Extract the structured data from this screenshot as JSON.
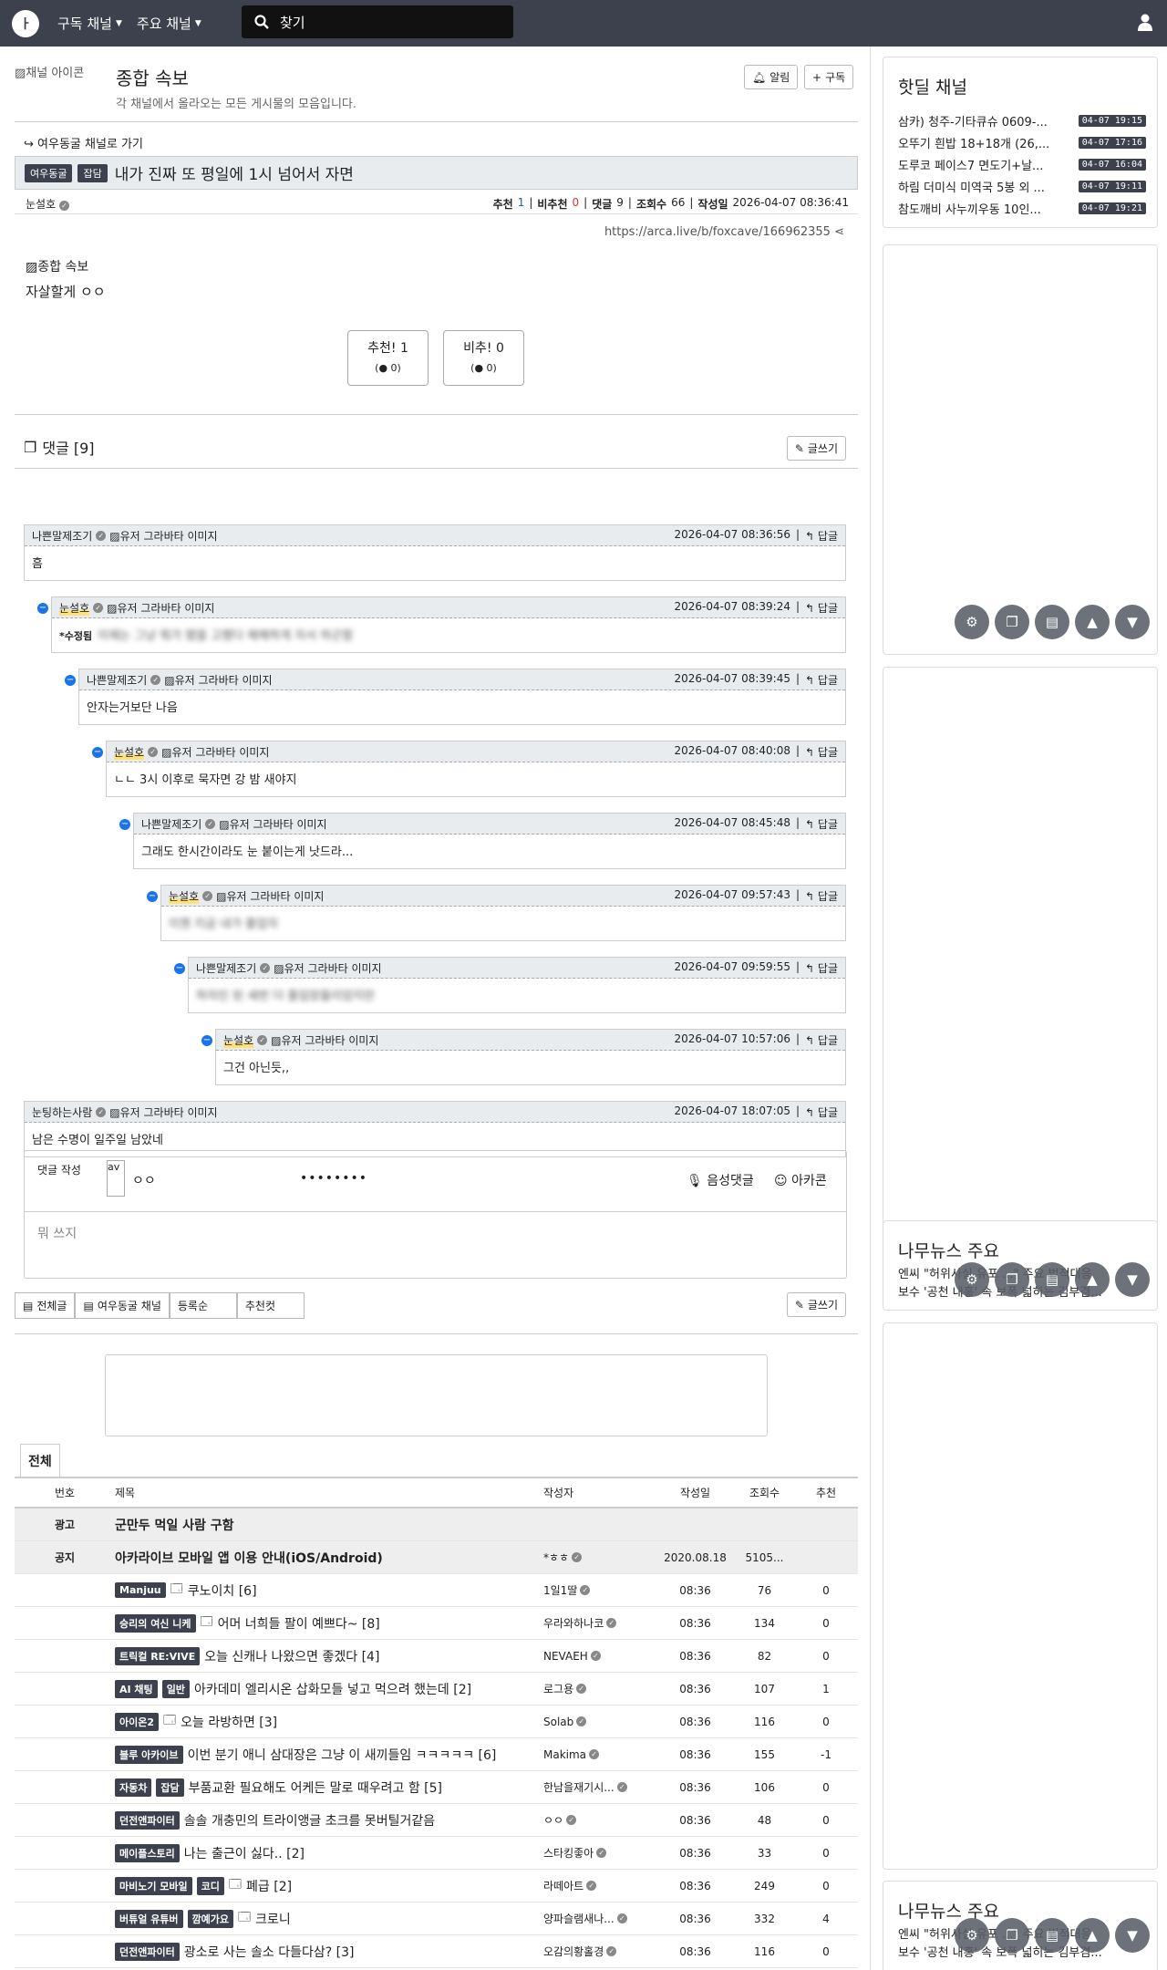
{
  "nav": {
    "menu1": "구독 채널",
    "menu2": "주요 채널",
    "search_placeholder": "찾기"
  },
  "header": {
    "channel_img_alt": "채널 아이콘",
    "title": "종합 속보",
    "desc": "각 채널에서 올라오는 모든 게시물의 모음입니다.",
    "alarm": "알림",
    "subscribe": "구독"
  },
  "post": {
    "goto": "여우동굴 채널로 가기",
    "cat1": "여우동굴",
    "cat2": "잡담",
    "title": "내가 진짜 또 평일에 1시 넘어서 자면",
    "author": "눈설호",
    "rec_label": "추천",
    "rec": "1",
    "unrec_label": "비추천",
    "unrec": "0",
    "cmt_label": "댓글",
    "cmt": "9",
    "view_label": "조회수",
    "views": "66",
    "date_label": "작성일",
    "date": "2026-04-07 08:36:41",
    "url": "https://arca.live/b/foxcave/166962355",
    "img_alt": "종합 속보",
    "body": "자살할게 ㅇㅇ",
    "vote_up": "추천! 1",
    "vote_up_sub": "0",
    "vote_down": "비추! 0",
    "vote_down_sub": "0"
  },
  "comments": {
    "header": "댓글 [9]",
    "write": "글쓰기",
    "reply": "답글",
    "avatar_alt": "유저 그라바타 이미지",
    "items": [
      {
        "author": "나쁜말제조기",
        "date": "2026-04-07 08:36:56",
        "text": "흠"
      },
      {
        "author": "눈설호",
        "date": "2026-04-07 08:39:24",
        "text": "이제는 그냥 뭐가 됐을 고했다 해해하게 자서 하곤함",
        "edited": "*수정됨"
      },
      {
        "author": "나쁜말제조기",
        "date": "2026-04-07 08:39:45",
        "text": "안자는거보단 나음"
      },
      {
        "author": "눈설호",
        "date": "2026-04-07 08:40:08",
        "text": "ㄴㄴ 3시 이후로 묵자면 강 밤 새야지"
      },
      {
        "author": "나쁜말제조기",
        "date": "2026-04-07 08:45:48",
        "text": "그래도 한시간이라도 눈 붙이는게 낫드라..."
      },
      {
        "author": "눈설호",
        "date": "2026-04-07 09:57:43",
        "text": "이젠 지금 내가 졸업자"
      },
      {
        "author": "나쁜말제조기",
        "date": "2026-04-07 09:59:55",
        "text": "하자인 된 세번 더 졸업장들이었지만"
      },
      {
        "author": "눈설호",
        "date": "2026-04-07 10:57:06",
        "text": "그건 아닌듯,,"
      },
      {
        "author": "눈팅하는사람",
        "date": "2026-04-07 18:07:05",
        "text": "남은 수명이 일주일 남았네"
      }
    ]
  },
  "form": {
    "label": "댓글 작성",
    "avatar": "av",
    "nick": "ㅇㅇ",
    "pw": "••••••••",
    "voice": "음성댓글",
    "arcacon": "아카콘",
    "placeholder": "뭐 쓰지"
  },
  "tabs": {
    "all": "전체글",
    "channel": "여우동굴 채널",
    "reg": "등록순",
    "best": "추천컷",
    "write": "글쓰기"
  },
  "list": {
    "tab": "전체",
    "headers": {
      "no": "번호",
      "title": "제목",
      "author": "작성자",
      "date": "작성일",
      "views": "조회수",
      "rec": "추천"
    },
    "ad": {
      "no": "광고",
      "title": "군만두 먹일 사람 구함"
    },
    "notice": {
      "no": "공지",
      "title": "아카라이브 모바일 앱 이용 안내(iOS/Android)",
      "author": "*ㅎㅎ",
      "date": "2020.08.18",
      "views": "5105..."
    },
    "rows": [
      {
        "badges": [
          "Manjuu"
        ],
        "icon": true,
        "title": "쿠노이치 [6]",
        "author": "1일1딸",
        "date": "08:36",
        "views": "76",
        "rec": "0"
      },
      {
        "badges": [
          "승리의 여신 니케"
        ],
        "icon": true,
        "title": "어머 너희들 팔이 예쁘다~ [8]",
        "author": "우라와하나코",
        "date": "08:36",
        "views": "134",
        "rec": "0"
      },
      {
        "badges": [
          "트릭컬 RE:VIVE"
        ],
        "icon": false,
        "title": "오늘 신캐나 나왔으면 좋겠다 [4]",
        "author": "NEVAEH",
        "date": "08:36",
        "views": "82",
        "rec": "0"
      },
      {
        "badges": [
          "AI 채팅",
          "일반"
        ],
        "icon": false,
        "title": "아카데미 엘리시온 삽화모들 넣고 먹으려 했는데 [2]",
        "author": "로그용",
        "date": "08:36",
        "views": "107",
        "rec": "1"
      },
      {
        "badges": [
          "아이온2"
        ],
        "icon": true,
        "title": "오늘 라방하면 [3]",
        "author": "Solab",
        "date": "08:36",
        "views": "116",
        "rec": "0"
      },
      {
        "badges": [
          "블루 아카이브"
        ],
        "icon": false,
        "title": "이번 분기 애니 삼대장은 그냥 이 새끼들임 ㅋㅋㅋㅋㅋ [6]",
        "author": "Makima",
        "date": "08:36",
        "views": "155",
        "rec": "-1"
      },
      {
        "badges": [
          "자동차",
          "잡담"
        ],
        "icon": false,
        "title": "부품교환 필요해도 어케든 말로 때우려고 함 [5]",
        "author": "한남을재기시...",
        "date": "08:36",
        "views": "106",
        "rec": "0"
      },
      {
        "badges": [
          "던전앤파이터"
        ],
        "icon": false,
        "title": "솔솔 개충민의 트라이앵글 초크를 못버틸거같음",
        "author": "ㅇㅇ",
        "date": "08:36",
        "views": "48",
        "rec": "0"
      },
      {
        "badges": [
          "메이플스토리"
        ],
        "icon": false,
        "title": "나는 출근이 싫다.. [2]",
        "author": "스타킹좋아",
        "date": "08:36",
        "views": "33",
        "rec": "0"
      },
      {
        "badges": [
          "마비노기 모바일",
          "코디"
        ],
        "icon": true,
        "title": "폐급 [2]",
        "author": "라떼아트",
        "date": "08:36",
        "views": "249",
        "rec": "0"
      },
      {
        "badges": [
          "버튜얼 유튜버",
          "깜예가요"
        ],
        "icon": true,
        "title": "크로니",
        "author": "양파슬램새나...",
        "date": "08:36",
        "views": "332",
        "rec": "4"
      },
      {
        "badges": [
          "던전앤파이터"
        ],
        "icon": false,
        "title": "광소로 사는 솔소 다들다삼? [3]",
        "author": "오감의황홀경",
        "date": "08:36",
        "views": "116",
        "rec": "0"
      }
    ]
  },
  "sidebar": {
    "hot_title": "핫딜 채널",
    "hot": [
      {
        "t": "삼카) 청주-기타큐슈 0609-...",
        "time": "04-07 19:15"
      },
      {
        "t": "오뚜기 흰밥 18+18개 (26,...",
        "time": "04-07 17:16"
      },
      {
        "t": "도루코 페이스7 면도기+날...",
        "time": "04-07 16:04"
      },
      {
        "t": "하림 더미식 미역국 5봉 외 ...",
        "time": "04-07 19:11"
      },
      {
        "t": "참도깨비 사누끼우동 10인...",
        "time": "04-07 19:21"
      }
    ],
    "news_title": "나무뉴스 주요",
    "news": [
      "엔씨 \"허위사실 유포 ...\" 주요 법적대응",
      "보수 '공천 내홍' 속 보폭 넓히는 김부겸..."
    ]
  }
}
